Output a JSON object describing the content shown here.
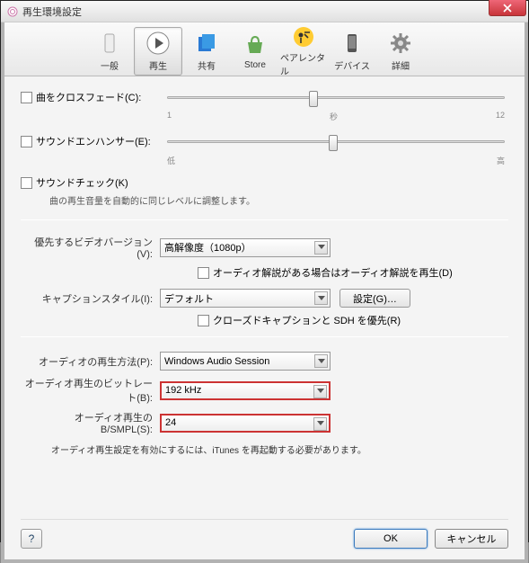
{
  "title": "再生環境設定",
  "toolbar": {
    "items": [
      {
        "label": "一般",
        "icon": "general"
      },
      {
        "label": "再生",
        "icon": "play"
      },
      {
        "label": "共有",
        "icon": "share"
      },
      {
        "label": "Store",
        "icon": "store"
      },
      {
        "label": "ペアレンタル",
        "icon": "parental"
      },
      {
        "label": "デバイス",
        "icon": "device"
      },
      {
        "label": "詳細",
        "icon": "advanced"
      }
    ]
  },
  "crossfade": {
    "label": "曲をクロスフェード(C):",
    "scale_left": "1",
    "scale_mid": "秒",
    "scale_right": "12"
  },
  "enhancer": {
    "label": "サウンドエンハンサー(E):",
    "scale_left": "低",
    "scale_right": "高"
  },
  "soundcheck": {
    "label": "サウンドチェック(K)",
    "desc": "曲の再生音量を自動的に同じレベルに調整します。"
  },
  "video": {
    "version_label": "優先するビデオバージョン(V):",
    "version_value": "高解像度（1080p）",
    "audio_desc_check": "オーディオ解説がある場合はオーディオ解説を再生(D)",
    "caption_label": "キャプションスタイル(I):",
    "caption_value": "デフォルト",
    "settings_btn": "設定(G)…",
    "cc_check": "クローズドキャプションと SDH を優先(R)"
  },
  "audio": {
    "method_label": "オーディオの再生方法(P):",
    "method_value": "Windows Audio Session",
    "bitrate_label": "オーディオ再生のビットレート(B):",
    "bitrate_value": "192 kHz",
    "bsmpl_label": "オーディオ再生の B/SMPL(S):",
    "bsmpl_value": "24",
    "note": "オーディオ再生設定を有効にするには、iTunes を再起動する必要があります。"
  },
  "buttons": {
    "help": "?",
    "ok": "OK",
    "cancel": "キャンセル"
  }
}
